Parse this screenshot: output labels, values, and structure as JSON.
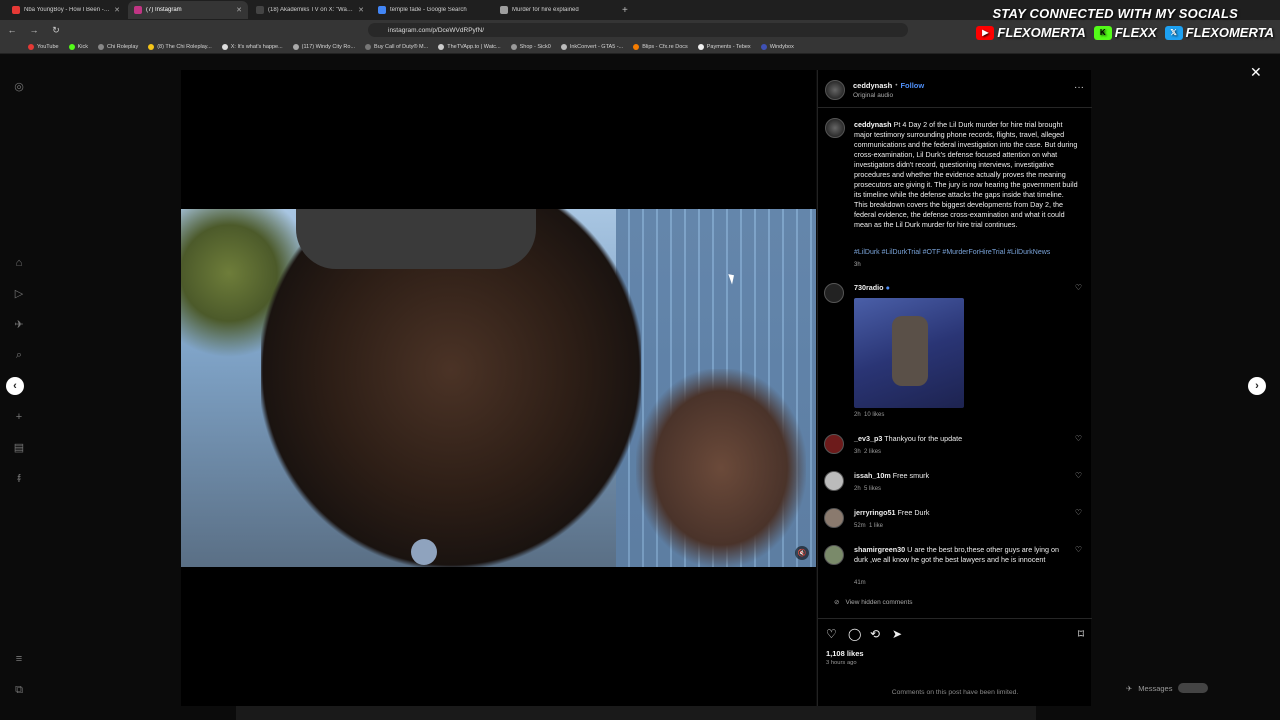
{
  "browser": {
    "tabs": [
      {
        "title": "Nba YoungBoy - How I Been - Yo",
        "color": "#e53935"
      },
      {
        "title": "(7) Instagram",
        "color": "#c13584"
      },
      {
        "title": "(18) Akademiks TV on X: \"Wack100",
        "color": "#444444"
      },
      {
        "title": "temple fade - Google Search",
        "color": "#4285f4"
      },
      {
        "title": "Murder for hire explained",
        "color": "#9e9e9e"
      }
    ],
    "url": "instagram.com/p/DceWVdRPyfN/",
    "bookmarks": [
      "YouTube",
      "Kick",
      "Chi Roleplay",
      "(8) The Chi Roleplay...",
      "X: It's what's happe...",
      "(117) Windy City Ro...",
      "Buy Call of Duty® M...",
      "TheTVApp.to | Watc...",
      "Shop - Sick0",
      "InkConvert - GTA5 -...",
      "Blips - Cfx.re Docs",
      "Payments - Tebex",
      "Windybox"
    ]
  },
  "socials": {
    "heading": "STAY CONNECTED WITH MY SOCIALS",
    "items": [
      {
        "name": "FLEXOMERTA",
        "color": "#ff0000",
        "icon": "youtube-icon"
      },
      {
        "name": "FLEXX",
        "color": "#53fc18",
        "icon": "kick-icon"
      },
      {
        "name": "FLEXOMERTA",
        "color": "#1da1f2",
        "icon": "x-icon"
      }
    ]
  },
  "post": {
    "author": "ceddynash",
    "follow": "Follow",
    "audio": "Original audio",
    "separator": "•",
    "caption": "Pt 4 Day 2 of the Lil Durk murder for hire trial brought major testimony surrounding phone records, flights, travel, alleged communications and the federal investigation into the case. But during cross-examination, Lil Durk's defense focused attention on what investigators didn't record, questioning interviews, investigative procedures and whether the evidence actually proves the meaning prosecutors are giving it. The jury is now hearing the government build its timeline while the defense attacks the gaps inside that timeline. This breakdown covers the biggest developments from Day 2, the federal evidence, the defense cross-examination and what it could mean as the Lil Durk murder for hire trial continues.",
    "hashtags": "#LilDurk #LilDurkTrial #OTF #MurderForHireTrial #LilDurkNews",
    "caption_age": "3h",
    "likes": "1,108 likes",
    "posted": "3 hours ago",
    "comments_limited": "Comments on this post have been limited.",
    "view_hidden": "View hidden comments"
  },
  "comments": [
    {
      "user": "730radio",
      "text": "",
      "age": "2h",
      "likes": "10 likes",
      "has_image": true
    },
    {
      "user": "_ev3_p3",
      "text": "Thankyou for the update",
      "age": "3h",
      "likes": "2 likes"
    },
    {
      "user": "issah_10m",
      "text": "Free smurk",
      "age": "2h",
      "likes": "5 likes"
    },
    {
      "user": "jerryringo51",
      "text": "Free Durk",
      "age": "52m",
      "likes": "1 like"
    },
    {
      "user": "shamirgreen30",
      "text": "U are the best bro,these other guys are lying on durk ,we all know he got the best lawyers and he is innocent",
      "age": "41m",
      "likes": ""
    }
  ],
  "messages": {
    "label": "Messages"
  }
}
